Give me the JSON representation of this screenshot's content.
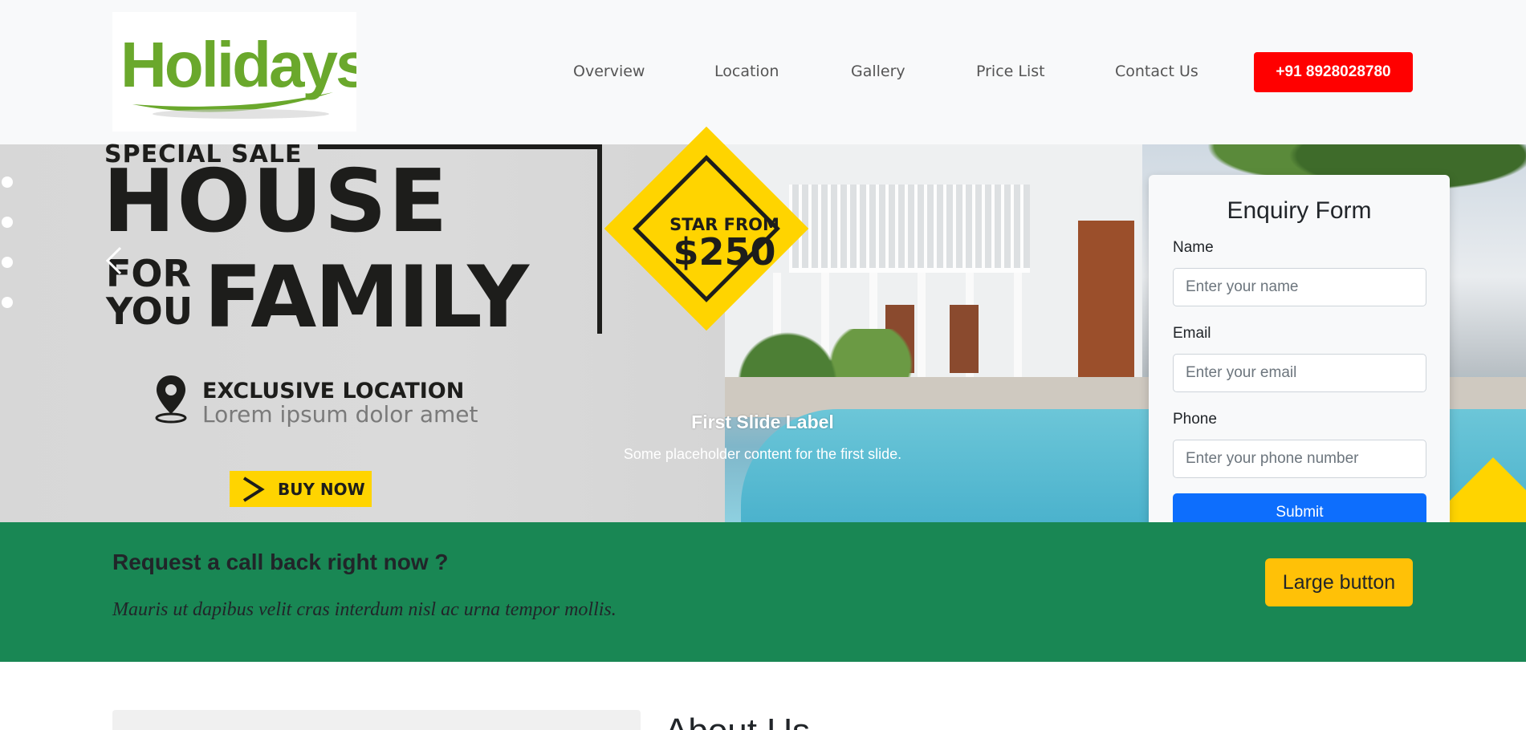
{
  "header": {
    "logo_text": "Holidays",
    "nav": [
      "Overview",
      "Location",
      "Gallery",
      "Price List",
      "Contact Us"
    ],
    "phone_label": "+91 8928028780"
  },
  "hero": {
    "ad": {
      "special_sale": "SPECIAL SALE",
      "house": "HOUSE",
      "for": "FOR",
      "you": "YOU",
      "family": "FAMILY",
      "star_from": "STAR FROM",
      "price": "$250",
      "exclusive_location": "EXCLUSIVE LOCATION",
      "lorem": "Lorem ipsum dolor amet",
      "buy_now": "BUY NOW"
    },
    "caption_title": "First Slide Label",
    "caption_text": "Some placeholder content for the first slide."
  },
  "form": {
    "title": "Enquiry Form",
    "name_label": "Name",
    "name_placeholder": "Enter your name",
    "email_label": "Email",
    "email_placeholder": "Enter your email",
    "phone_label": "Phone",
    "phone_placeholder": "Enter your phone number",
    "submit_label": "Submit"
  },
  "cta": {
    "title": "Request a call back right now ?",
    "text": "Mauris ut dapibus velit cras interdum nisl ac urna tempor mollis.",
    "button_label": "Large button"
  },
  "about": {
    "title": "About Us"
  },
  "colors": {
    "brand_green": "#6aa82c",
    "phone_red": "#ff0000",
    "cta_green": "#198754",
    "primary_blue": "#0d6efd",
    "warning_yellow": "#ffc107",
    "ad_yellow": "#ffd400"
  }
}
